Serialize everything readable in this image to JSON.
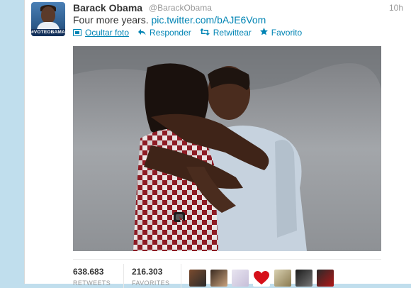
{
  "tweet": {
    "author_name": "Barack Obama",
    "author_handle": "@BarackObama",
    "time": "10h",
    "text": "Four more years.",
    "link_text": "pic.twitter.com/bAJE6Vom",
    "avatar_tag": "#VOTEOBAMA"
  },
  "actions": {
    "hide_photo": "Ocultar foto",
    "reply": "Responder",
    "retweet": "Retwittear",
    "favorite": "Favorito"
  },
  "stats": {
    "retweets_count": "638.683",
    "retweets_label": "RETWEETS",
    "favorites_count": "216.303",
    "favorites_label": "FAVORITES"
  },
  "colors": {
    "link": "#0084b4",
    "page_background": "#c0deed"
  },
  "icons": {
    "hide_photo": "photo-icon",
    "reply": "reply-arrow-icon",
    "retweet": "retweet-icon",
    "favorite": "star-icon"
  }
}
